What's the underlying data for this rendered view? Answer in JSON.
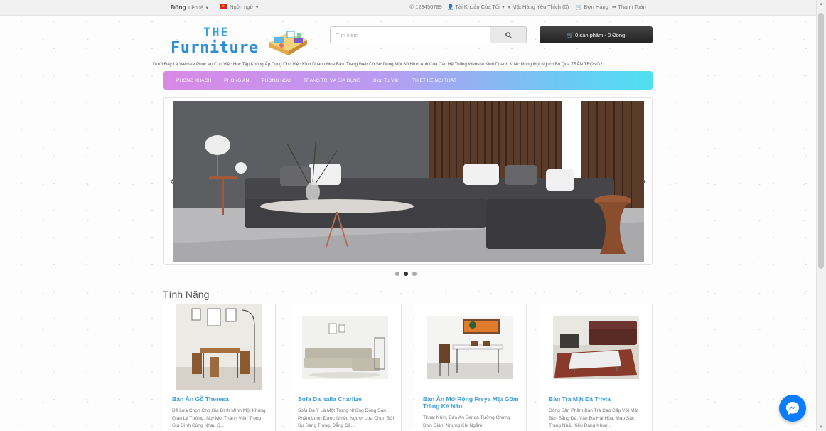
{
  "topbar": {
    "currency_value": "Đồng",
    "currency_label": "Tiền tệ",
    "language_label": "Ngôn ngữ",
    "phone": "123456789",
    "account": "Tài Khoản Của Tôi",
    "wishlist": "Mặt Hàng Yêu Thích (0)",
    "orders": "Đơn Hàng",
    "checkout": "Thanh Toán"
  },
  "logo": {
    "line1": "THE",
    "line2": "Furniture"
  },
  "search": {
    "placeholder": "Tìm kiếm"
  },
  "cart": {
    "label": "0 sản phẩm - 0 Đồng"
  },
  "tagline": "Dưới Đây Là Website Phục Vụ Cho Việc Học Tập Không Áp Dụng Cho Việc Kinh Doanh Mua Bán. Trang Web Có Sử Dụng Một Số Hình Ảnh Của Các Hệ Thống Website Kinh Doanh Khác Mong Mọi Người Bỏ Qua.TRẦN TRỌNG !",
  "nav": {
    "items": [
      {
        "label": "PHÒNG KHÁCH"
      },
      {
        "label": "PHÒNG ĂN"
      },
      {
        "label": "PHÒNG NGỦ"
      },
      {
        "label": "TRANG TRÍ VÀ GIA DỤNG"
      },
      {
        "label": "Blog Tư Vấn"
      },
      {
        "label": "THIẾT KẾ NỘI THẤT"
      }
    ]
  },
  "slider": {
    "active_dot": 2,
    "dot_count": 3
  },
  "section": {
    "title": "Tính Năng"
  },
  "products": [
    {
      "title": "Bàn Ăn Gỗ Theresa",
      "desc": "Để Lựa Chọn Cho Gia Đình Mình Một Không Gian Lý Tưởng, Nơi Mọi Thành Viên Trong Gia Đình Cùng Nhau Q..."
    },
    {
      "title": "Sofa Da Italia Charlize",
      "desc": "Sofa Da Ý Là Một Trong Những Dòng Sản Phẩm Luôn Được Nhiều Người Lựa Chọn Bởi Sự Sang Trọng, Đẳng Cấ..."
    },
    {
      "title": "Bàn Ăn Mở Rộng Freya Mặt Gốm Trắng Kẻ Nâu",
      "desc": "Thoạt Nhìn, Bàn Ăn Senda Tưởng Chừng Đơn Giản, Nhưng Khi Ngắm"
    },
    {
      "title": "Bàn Trà Mặt Đá Trivia",
      "desc": "Dòng Sản Phẩm Bàn Trà Cao Cấp Với Mặt Bàn Bằng Đá. Vân Đá Hài Hòa, Màu Sắc Trang Nhã, Kiểu Dáng Khun..."
    }
  ],
  "colors": {
    "accent": "#3a9bd9",
    "cart": "#2b2b2b",
    "messenger": "#0a7cff"
  }
}
